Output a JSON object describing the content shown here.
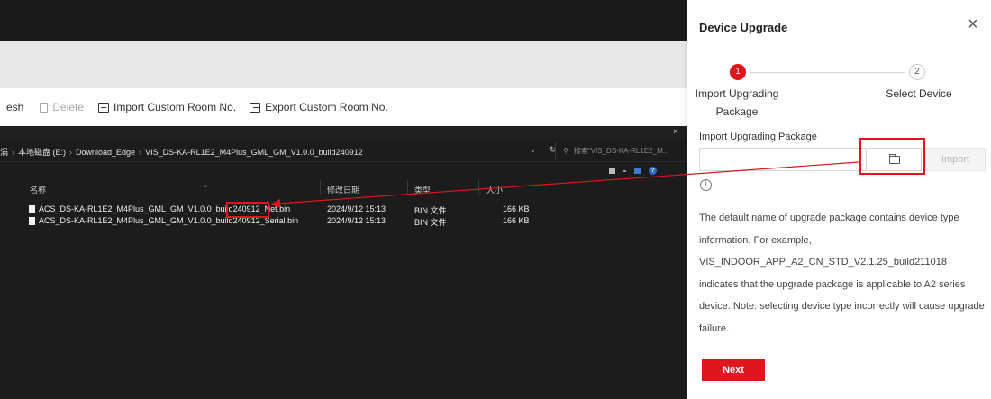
{
  "app": {
    "toolbar": {
      "refresh_label": "esh",
      "delete_label": "Delete",
      "import_label": "Import Custom Room No.",
      "export_label": "Export Custom Room No."
    }
  },
  "explorer": {
    "close": "×",
    "breadcrumb": [
      "涡",
      "本地磁盘 (E:)",
      "Download_Edge",
      "VIS_DS-KA-RL1E2_M4Plus_GML_GM_V1.0.0_build240912"
    ],
    "search_placeholder": "搜索\"VIS_DS-KA-RL1E2_M...",
    "columns": [
      "名称",
      "修改日期",
      "类型",
      "大小"
    ],
    "files": [
      {
        "name_prefix": "ACS_DS-KA-RL1E2_M4Plus_GML_GM_V1.0.0_build240912_",
        "name_suffix": "Net.bin",
        "modified": "2024/9/12 15:13",
        "type": "BIN 文件",
        "size": "166 KB"
      },
      {
        "name_prefix": "ACS_DS-KA-RL1E2_M4Plus_GML_GM_V1.0.0_build240912_",
        "name_suffix": "Serial.bin",
        "modified": "2024/9/12 15:13",
        "type": "BIN 文件",
        "size": "166 KB"
      }
    ]
  },
  "panel": {
    "title": "Device Upgrade",
    "close": "×",
    "steps": [
      {
        "number": "1",
        "label": "Import Upgrading Package",
        "state": "active"
      },
      {
        "number": "2",
        "label": "Select Device",
        "state": "pending"
      }
    ],
    "import_label": "Import Upgrading Package",
    "file_value": "",
    "import_button": "Import",
    "info_icon": "i",
    "description": "The default name of upgrade package contains device type information. For example, VIS_INDOOR_APP_A2_CN_STD_V2.1.25_build211018 indicates that the upgrade package is applicable to A2 series device. Note: selecting device type incorrectly will cause upgrade failure.",
    "next_button": "Next"
  },
  "colors": {
    "accent_red": "#e0161e",
    "explorer_bg": "#1c1c1c",
    "header_dark": "#1a1b1d"
  }
}
